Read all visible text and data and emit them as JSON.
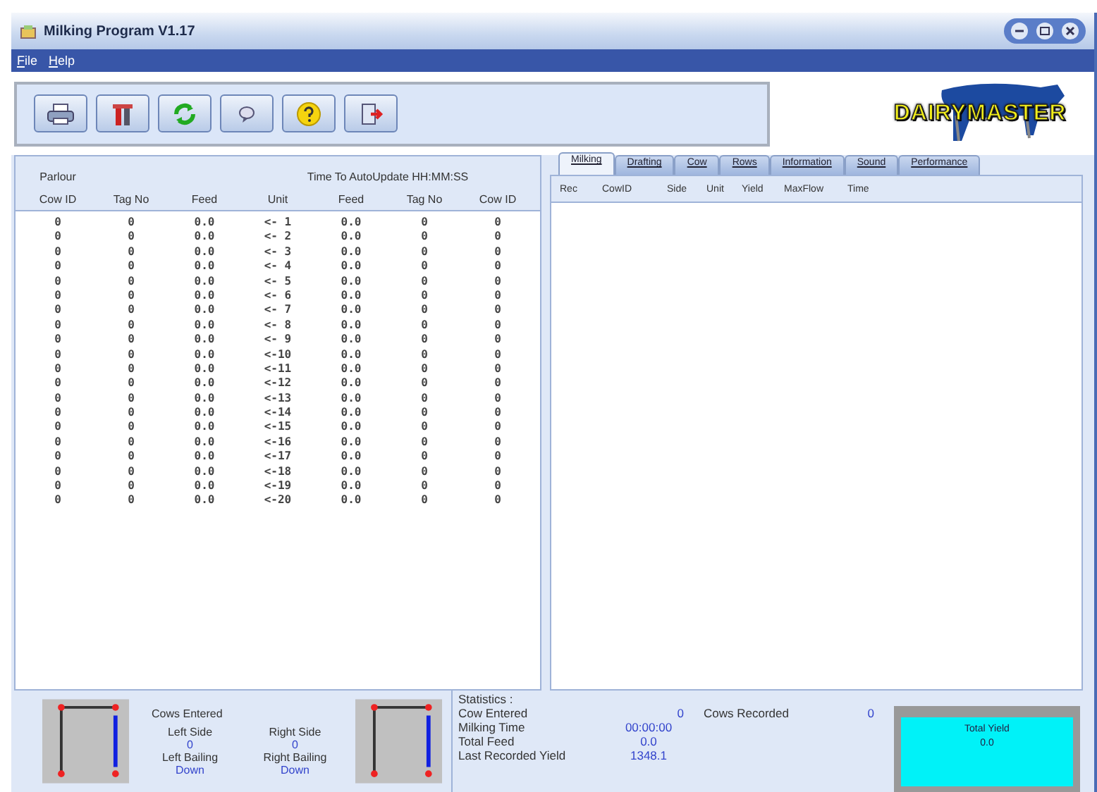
{
  "window": {
    "title": "Milking Program V1.17"
  },
  "menu": [
    "File",
    "Help"
  ],
  "toolbar": [
    {
      "kind": "print"
    },
    {
      "kind": "tools"
    },
    {
      "kind": "refresh"
    },
    {
      "kind": "message"
    },
    {
      "kind": "help"
    },
    {
      "kind": "exit"
    }
  ],
  "logo": {
    "text": "DAIRYMASTER"
  },
  "parlour": {
    "title": "Parlour",
    "update_label": "Time To AutoUpdate HH:MM:SS",
    "columns": [
      "Cow ID",
      "Tag No",
      "Feed",
      "Unit",
      "Feed",
      "Tag No",
      "Cow ID"
    ],
    "rows": [
      [
        "0",
        "0",
        "0.0",
        "<- 1",
        "0.0",
        "0",
        "0"
      ],
      [
        "0",
        "0",
        "0.0",
        "<- 2",
        "0.0",
        "0",
        "0"
      ],
      [
        "0",
        "0",
        "0.0",
        "<- 3",
        "0.0",
        "0",
        "0"
      ],
      [
        "0",
        "0",
        "0.0",
        "<- 4",
        "0.0",
        "0",
        "0"
      ],
      [
        "0",
        "0",
        "0.0",
        "<- 5",
        "0.0",
        "0",
        "0"
      ],
      [
        "0",
        "0",
        "0.0",
        "<- 6",
        "0.0",
        "0",
        "0"
      ],
      [
        "0",
        "0",
        "0.0",
        "<- 7",
        "0.0",
        "0",
        "0"
      ],
      [
        "0",
        "0",
        "0.0",
        "<- 8",
        "0.0",
        "0",
        "0"
      ],
      [
        "0",
        "0",
        "0.0",
        "<- 9",
        "0.0",
        "0",
        "0"
      ],
      [
        "0",
        "0",
        "0.0",
        "<-10",
        "0.0",
        "0",
        "0"
      ],
      [
        "0",
        "0",
        "0.0",
        "<-11",
        "0.0",
        "0",
        "0"
      ],
      [
        "0",
        "0",
        "0.0",
        "<-12",
        "0.0",
        "0",
        "0"
      ],
      [
        "0",
        "0",
        "0.0",
        "<-13",
        "0.0",
        "0",
        "0"
      ],
      [
        "0",
        "0",
        "0.0",
        "<-14",
        "0.0",
        "0",
        "0"
      ],
      [
        "0",
        "0",
        "0.0",
        "<-15",
        "0.0",
        "0",
        "0"
      ],
      [
        "0",
        "0",
        "0.0",
        "<-16",
        "0.0",
        "0",
        "0"
      ],
      [
        "0",
        "0",
        "0.0",
        "<-17",
        "0.0",
        "0",
        "0"
      ],
      [
        "0",
        "0",
        "0.0",
        "<-18",
        "0.0",
        "0",
        "0"
      ],
      [
        "0",
        "0",
        "0.0",
        "<-19",
        "0.0",
        "0",
        "0"
      ],
      [
        "0",
        "0",
        "0.0",
        "<-20",
        "0.0",
        "0",
        "0"
      ]
    ]
  },
  "tabs": [
    {
      "label": "Milking",
      "selected": true
    },
    {
      "label": "Drafting",
      "selected": false
    },
    {
      "label": "Cow",
      "selected": false
    },
    {
      "label": "Rows",
      "selected": false
    },
    {
      "label": "Information",
      "selected": false
    },
    {
      "label": "Sound",
      "selected": false
    },
    {
      "label": "Performance",
      "selected": false
    }
  ],
  "milking_columns": [
    "Rec",
    "CowID",
    "Side",
    "Unit",
    "Yield",
    "MaxFlow",
    "Time"
  ],
  "cows_entered": {
    "title": "Cows Entered",
    "left_side_label": "Left Side",
    "left_side": "0",
    "right_side_label": "Right Side",
    "right_side": "0",
    "left_bailing_label": "Left Bailing",
    "left_bailing": "Down",
    "right_bailing_label": "Right Bailing",
    "right_bailing": "Down"
  },
  "statistics": {
    "title": "Statistics :",
    "items": [
      {
        "label": "Cow Entered",
        "value": "0",
        "extra_label": "Cows Recorded",
        "extra_value": "0"
      },
      {
        "label": "Milking Time",
        "value": "00:00:00"
      },
      {
        "label": "Total Feed",
        "value": "0.0"
      },
      {
        "label": "Last Recorded Yield",
        "value": "1348.1"
      }
    ]
  },
  "total_yield": {
    "label": "Total Yield",
    "value": "0.0"
  }
}
